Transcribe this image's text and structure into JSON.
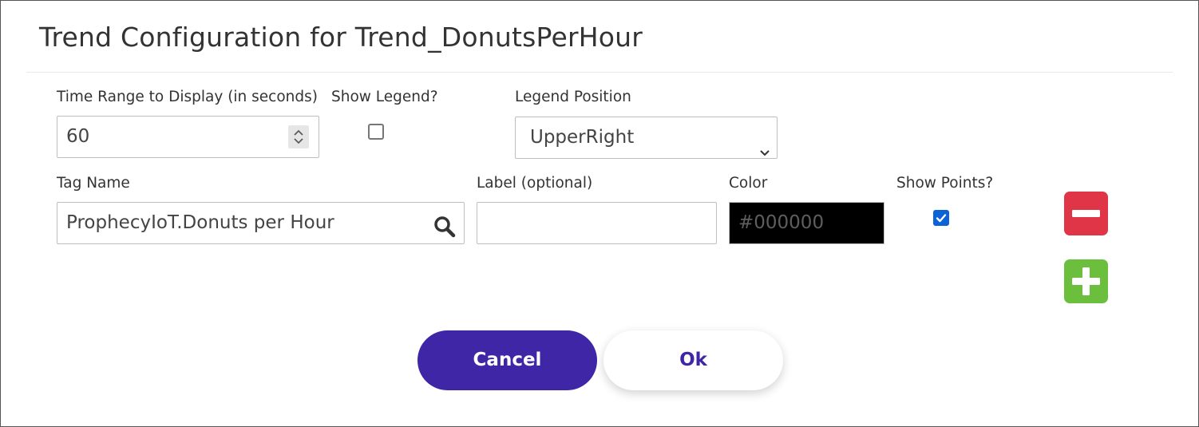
{
  "dialog": {
    "title": "Trend Configuration for Trend_DonutsPerHour"
  },
  "settings": {
    "time_range_label": "Time Range to Display (in seconds)",
    "time_range_value": "60",
    "show_legend_label": "Show Legend?",
    "show_legend_checked": false,
    "legend_position_label": "Legend Position",
    "legend_position_value": "UpperRight"
  },
  "series_row": {
    "tag_name_label": "Tag Name",
    "tag_name_value": "ProphecyIoT.Donuts per Hour",
    "label_label": "Label (optional)",
    "label_value": "",
    "color_label": "Color",
    "color_placeholder": "#000000",
    "color_value": "#000000",
    "show_points_label": "Show Points?",
    "show_points_checked": true
  },
  "icons": {
    "search": "search-icon",
    "remove": "minus-icon",
    "add": "plus-icon",
    "spinner": "spinner-arrows-icon",
    "chevron": "chevron-down-icon"
  },
  "buttons": {
    "cancel_label": "Cancel",
    "ok_label": "Ok"
  },
  "colors": {
    "primary": "#3f26a6",
    "remove": "#e03546",
    "add": "#6bbf3d",
    "checkbox_on": "#0b63d6"
  }
}
